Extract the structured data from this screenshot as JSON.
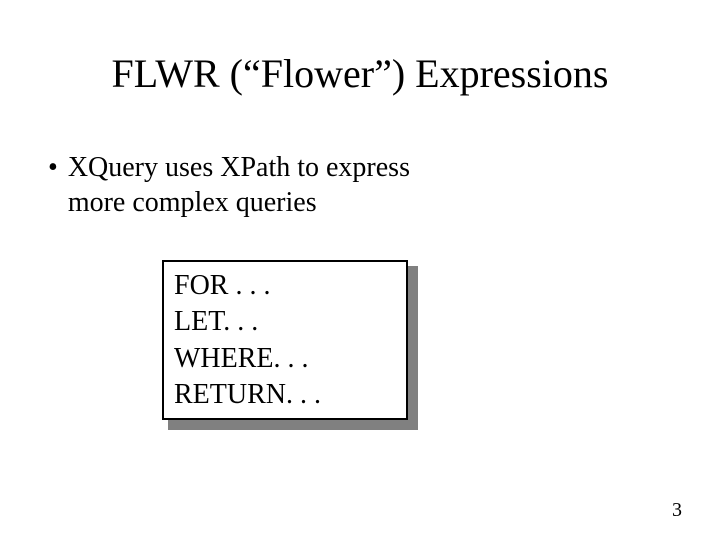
{
  "title": "FLWR (“Flower”) Expressions",
  "bullet": {
    "marker": "•",
    "line1": "XQuery uses XPath to express",
    "line2": "more complex queries"
  },
  "code": {
    "line1": "FOR . . .",
    "line2": "LET. . .",
    "line3": "WHERE. . .",
    "line4": "RETURN. . ."
  },
  "page_number": "3"
}
